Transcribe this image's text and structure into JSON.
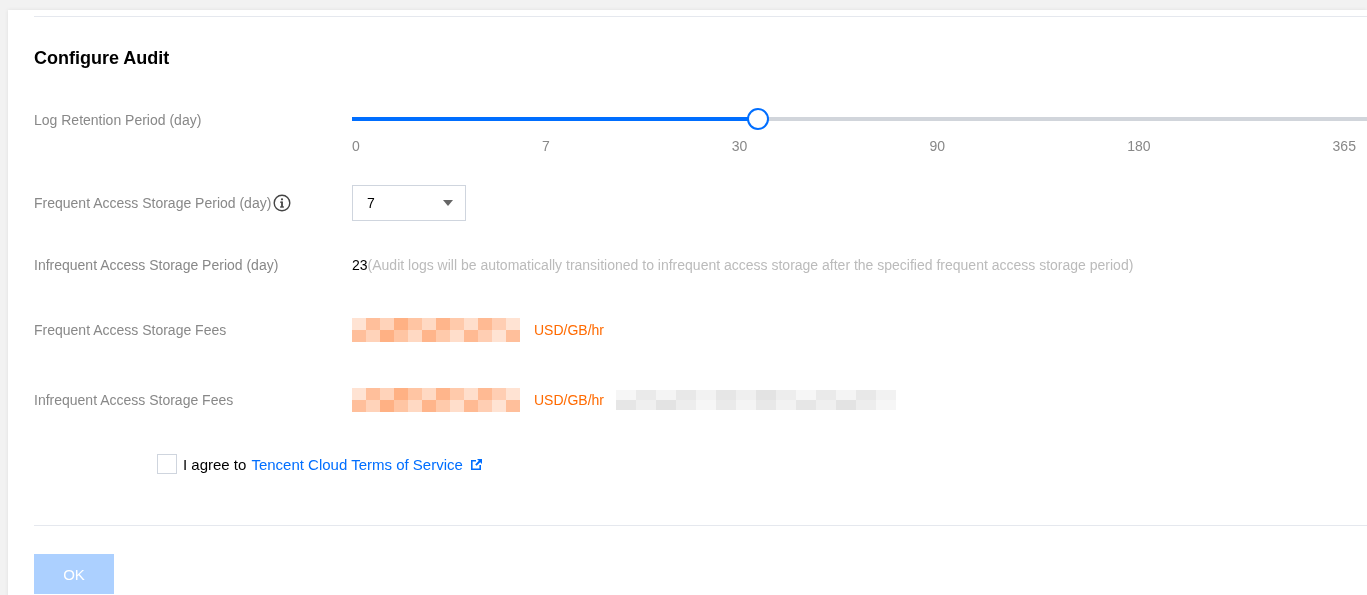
{
  "title": "Configure Audit",
  "retention": {
    "label": "Log Retention Period (day)",
    "level": 0.4,
    "ticks": [
      "0",
      "7",
      "30",
      "90",
      "180",
      "365"
    ]
  },
  "frequent_period": {
    "label": "Frequent Access Storage Period (day)",
    "value": "7"
  },
  "infrequent_period": {
    "label": "Infrequent Access Storage Period (day)",
    "value": "23",
    "note": "(Audit logs will be automatically transitioned to infrequent access storage after the specified frequent access storage period)"
  },
  "fees": [
    {
      "label": "Frequent Access Storage Fees",
      "value_redacted": true,
      "unit": "USD/GB/hr",
      "note_redacted": false
    },
    {
      "label": "Infrequent Access Storage Fees",
      "value_redacted": true,
      "unit": "USD/GB/hr",
      "note_redacted": true
    }
  ],
  "agreement": {
    "checked": false,
    "text": "I agree to",
    "link": "Tencent Cloud Terms of Service"
  },
  "ok_button": {
    "label": "OK",
    "disabled": true
  }
}
